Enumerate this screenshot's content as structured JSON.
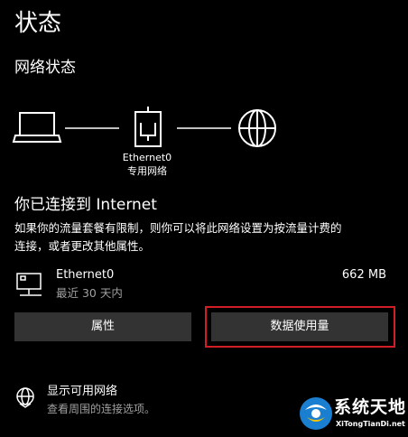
{
  "page": {
    "title": "状态",
    "subtitle": "网络状态"
  },
  "diagram": {
    "adapter_name": "Ethernet0",
    "adapter_type": "专用网络"
  },
  "status": {
    "heading": "你已连接到 Internet",
    "description_line1": "如果你的流量套餐有限制，则你可以将此网络设置为按流量计费的",
    "description_line2": "连接，或者更改其他属性。"
  },
  "adapter": {
    "name": "Ethernet0",
    "period": "最近 30 天内",
    "usage": "662 MB"
  },
  "buttons": {
    "properties": "属性",
    "data_usage": "数据使用量"
  },
  "available_networks": {
    "title": "显示可用网络",
    "subtitle": "查看周围的连接选项。"
  },
  "watermark": {
    "brand": "系统天地",
    "url": "XiTongTianDi.net"
  },
  "colors": {
    "background": "#000000",
    "text": "#ffffff",
    "secondary_text": "#a0a0a0",
    "button": "#333333",
    "highlight": "#d11e25"
  }
}
